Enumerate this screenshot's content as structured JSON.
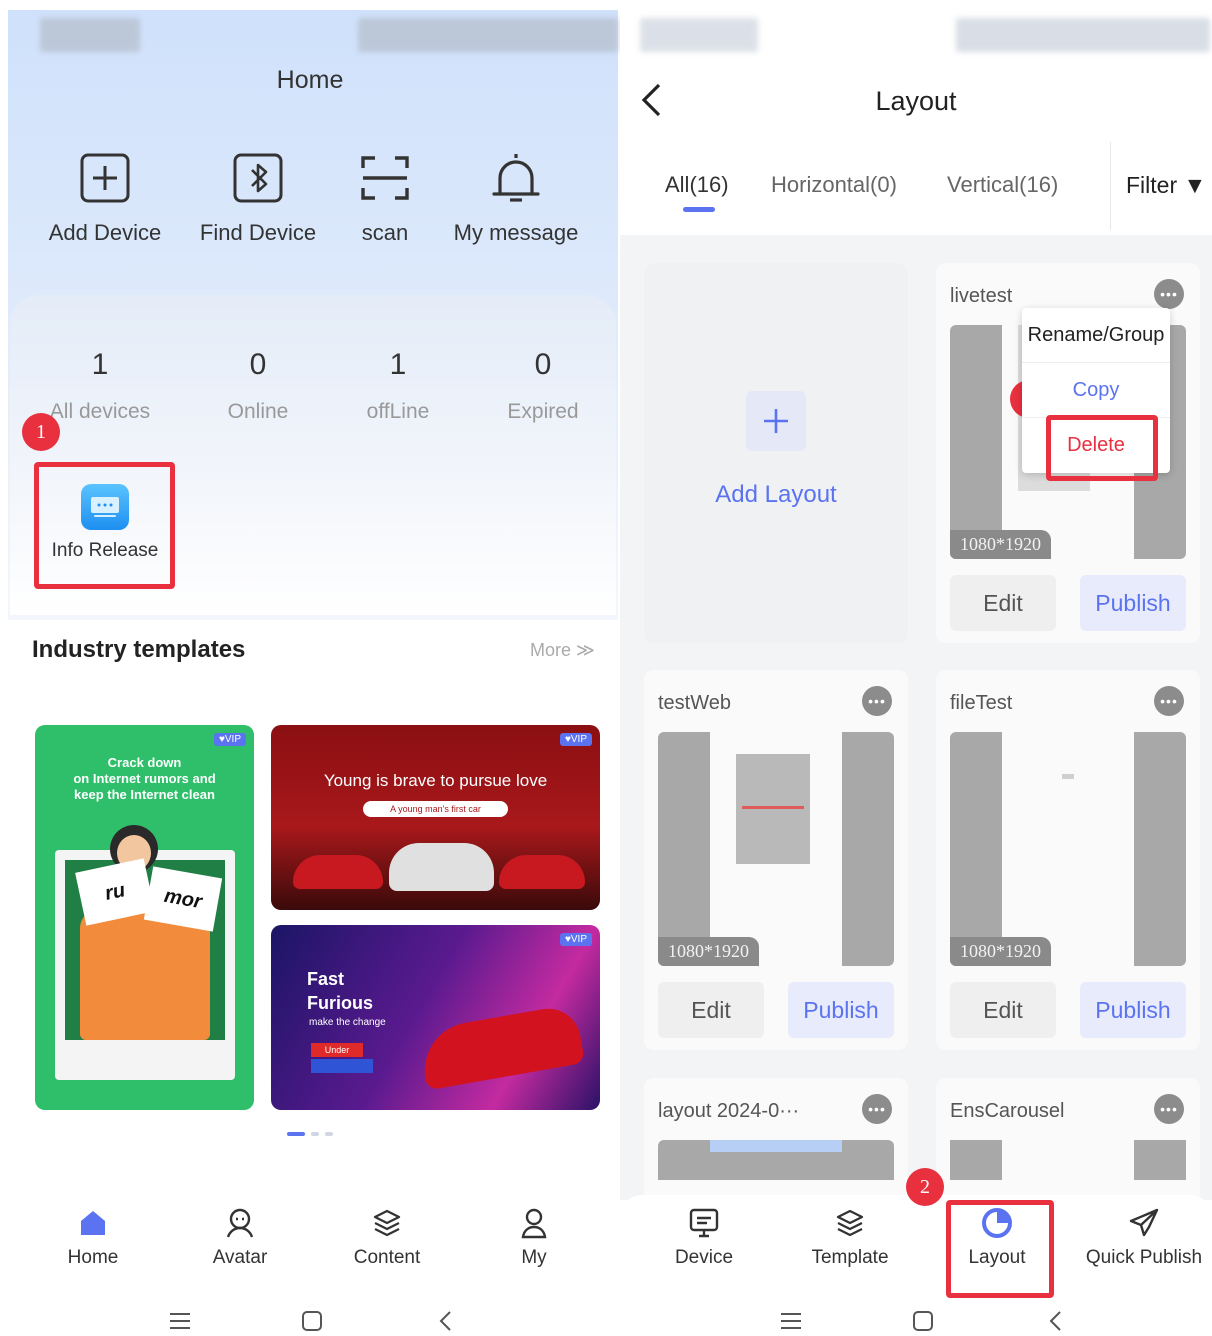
{
  "left": {
    "title": "Home",
    "quick_actions": [
      {
        "label": "Add Device",
        "icon": "plus-square-icon"
      },
      {
        "label": "Find Device",
        "icon": "bluetooth-icon"
      },
      {
        "label": "scan",
        "icon": "scan-icon"
      },
      {
        "label": "My message",
        "icon": "bell-icon"
      }
    ],
    "stats": [
      {
        "value": "1",
        "label": "All devices"
      },
      {
        "value": "0",
        "label": "Online"
      },
      {
        "value": "1",
        "label": "offLine"
      },
      {
        "value": "0",
        "label": "Expired"
      }
    ],
    "step_badge_1": "1",
    "info_release": {
      "label": "Info Release",
      "icon": "monitor-app-icon"
    },
    "industry": {
      "title": "Industry templates",
      "more": "More ≫"
    },
    "templates": [
      {
        "badge": "♥VIP",
        "lines": [
          "Crack down",
          "on Internet rumors and",
          "keep the Internet clean"
        ],
        "words": [
          "ru",
          "mor"
        ]
      },
      {
        "badge": "♥VIP",
        "headline": "Young is brave to pursue love",
        "sub": "A young man's first car"
      },
      {
        "badge": "♥VIP",
        "headline": "Fast",
        "headline2": "Furious",
        "sub": "make the change",
        "tag": "Under"
      }
    ],
    "tabs": [
      {
        "label": "Home",
        "icon": "home-icon"
      },
      {
        "label": "Avatar",
        "icon": "avatar-icon"
      },
      {
        "label": "Content",
        "icon": "layers-icon"
      },
      {
        "label": "My",
        "icon": "user-icon"
      }
    ]
  },
  "right": {
    "title": "Layout",
    "segments": [
      "All(16)",
      "Horizontal(0)",
      "Vertical(16)"
    ],
    "filter": "Filter ▼",
    "add_layout": "Add Layout",
    "cards": [
      {
        "name": "livetest",
        "resolution": "1080*1920",
        "edit": "Edit",
        "publish": "Publish"
      },
      {
        "name": "testWeb",
        "resolution": "1080*1920",
        "edit": "Edit",
        "publish": "Publish"
      },
      {
        "name": "fileTest",
        "resolution": "1080*1920",
        "edit": "Edit",
        "publish": "Publish"
      },
      {
        "name": "layout 2024-0···"
      },
      {
        "name": "EnsCarousel"
      }
    ],
    "menu": {
      "rename": "Rename/Group",
      "copy": "Copy",
      "delete": "Delete"
    },
    "step_badge_2": "2",
    "step_badge_3": "3",
    "tabs": [
      {
        "label": "Device",
        "icon": "device-icon"
      },
      {
        "label": "Template",
        "icon": "layers-icon"
      },
      {
        "label": "Layout",
        "icon": "layout-icon"
      },
      {
        "label": "Quick Publish",
        "icon": "send-icon"
      }
    ]
  },
  "colors": {
    "accent": "#5b73f0",
    "highlight_red": "#e8303f"
  }
}
